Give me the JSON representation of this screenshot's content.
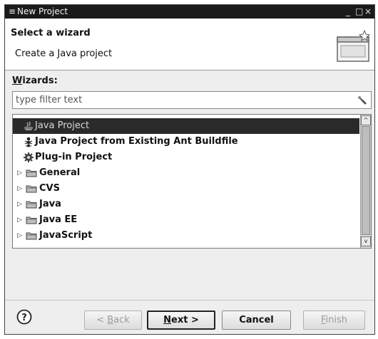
{
  "window": {
    "menu_glyph": "≡",
    "title": "New Project",
    "minimize_glyph": "_",
    "maximize_glyph": "□",
    "close_glyph": "×"
  },
  "banner": {
    "heading": "Select a wizard",
    "description": "Create a Java project"
  },
  "wizards": {
    "label_mnemonic": "W",
    "label_rest": "izards:",
    "filter_placeholder": "type filter text",
    "filter_value": ""
  },
  "tree": {
    "items": [
      {
        "label": "Java Project",
        "type": "leaf",
        "icon": "java-project-icon",
        "selected": true
      },
      {
        "label": "Java Project from Existing Ant Buildfile",
        "type": "leaf",
        "icon": "ant-icon",
        "selected": false
      },
      {
        "label": "Plug-in Project",
        "type": "leaf",
        "icon": "plugin-icon",
        "selected": false
      },
      {
        "label": "General",
        "type": "folder",
        "icon": "folder-icon",
        "selected": false
      },
      {
        "label": "CVS",
        "type": "folder",
        "icon": "folder-icon",
        "selected": false
      },
      {
        "label": "Java",
        "type": "folder",
        "icon": "folder-icon",
        "selected": false
      },
      {
        "label": "Java EE",
        "type": "folder",
        "icon": "folder-icon",
        "selected": false
      },
      {
        "label": "JavaScript",
        "type": "folder",
        "icon": "folder-icon",
        "selected": false
      }
    ],
    "expander_glyph": "▷",
    "scroll_up_glyph": "^",
    "scroll_down_glyph": "v"
  },
  "buttons": {
    "back_prefix": "< ",
    "back_mnemonic": "B",
    "back_rest": "ack",
    "next_mnemonic": "N",
    "next_rest": "ext >",
    "cancel": "Cancel",
    "finish_mnemonic": "F",
    "finish_rest": "inish",
    "back_enabled": false,
    "finish_enabled": false
  },
  "colors": {
    "selection_bg": "#2a2a2a",
    "titlebar_bg": "#1a1a1a"
  }
}
